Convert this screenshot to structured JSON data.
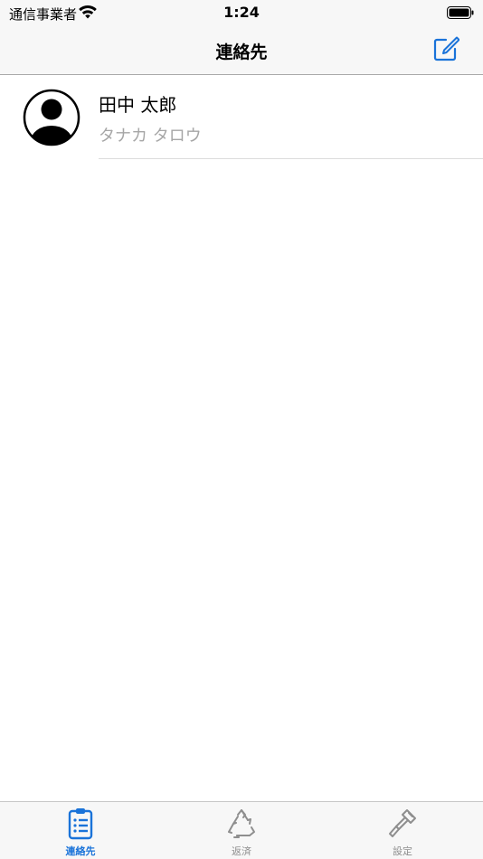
{
  "status_bar": {
    "carrier": "通信事業者",
    "time": "1:24",
    "wifi_icon": "wifi-icon",
    "battery_icon": "battery-icon"
  },
  "nav": {
    "title": "連絡先",
    "compose_icon": "compose-icon"
  },
  "contacts": [
    {
      "name": "田中 太郎",
      "kana": "タナカ タロウ",
      "avatar_icon": "person-avatar-icon"
    }
  ],
  "tabs": [
    {
      "label": "連絡先",
      "icon": "list-clipboard-icon",
      "active": true
    },
    {
      "label": "返済",
      "icon": "recycle-icon",
      "active": false
    },
    {
      "label": "設定",
      "icon": "screwdriver-icon",
      "active": false
    }
  ],
  "colors": {
    "accent": "#1a73d9",
    "inactive": "#8e8e8e",
    "secondary_text": "#a6a6a6",
    "bar_background": "#f7f7f7"
  }
}
